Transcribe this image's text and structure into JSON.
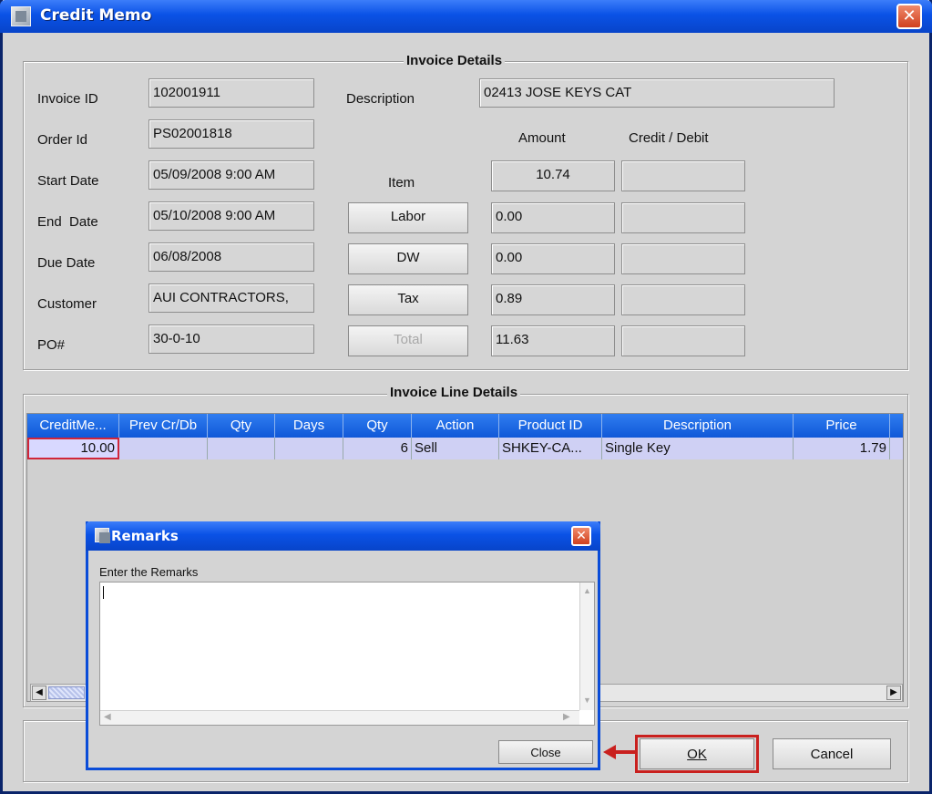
{
  "window": {
    "title": "Credit Memo",
    "close_glyph": "✕"
  },
  "invoice_details": {
    "title": "Invoice Details",
    "labels": {
      "invoice_id": "Invoice ID",
      "order_id": "Order Id",
      "start_date": "Start Date",
      "end_date": "End  Date",
      "due_date": "Due Date",
      "customer": "Customer",
      "po": "PO#",
      "description": "Description",
      "amount": "Amount",
      "credit_debit": "Credit / Debit",
      "item": "Item"
    },
    "values": {
      "invoice_id": "102001911",
      "order_id": "PS02001818",
      "start_date": "05/09/2008 9:00 AM",
      "end_date": "05/10/2008 9:00 AM",
      "due_date": "06/08/2008",
      "customer": "AUI CONTRACTORS,",
      "po": "30-0-10",
      "description": "02413 JOSE KEYS CAT"
    },
    "buttons": {
      "labor": "Labor",
      "dw": "DW",
      "tax": "Tax",
      "total": "Total"
    },
    "amounts": {
      "item": "10.74",
      "labor": "0.00",
      "dw": "0.00",
      "tax": "0.89",
      "total": "11.63"
    }
  },
  "line_details": {
    "title": "Invoice Line Details",
    "columns": [
      "CreditMe...",
      "Prev Cr/Db",
      "Qty",
      "Days",
      "Qty",
      "Action",
      "Product ID",
      "Description",
      "Price"
    ],
    "rows": [
      [
        "10.00",
        "",
        "",
        "",
        "6",
        "Sell",
        "SHKEY-CA...",
        "Single Key",
        "1.79"
      ]
    ]
  },
  "remarks": {
    "title": "Remarks",
    "prompt": "Enter the Remarks",
    "text": "",
    "close_label": "Close"
  },
  "footer": {
    "ok_label": "OK",
    "cancel_label": "Cancel"
  },
  "colors": {
    "title_bar": "#0a52e6",
    "header": "#1058d8",
    "highlight": "#c9201e"
  }
}
